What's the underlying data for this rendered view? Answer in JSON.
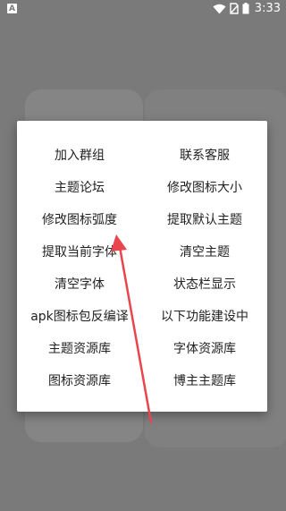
{
  "status_bar": {
    "app_badge": "A",
    "time": "3:33"
  },
  "menu": {
    "items": [
      "加入群组",
      "联系客服",
      "主题论坛",
      "修改图标大小",
      "修改图标弧度",
      "提取默认主题",
      "提取当前字体",
      "清空主题",
      "清空字体",
      "状态栏显示",
      "apk图标包反编译",
      "以下功能建设中",
      "主题资源库",
      "字体资源库",
      "图标资源库",
      "博主主题库"
    ]
  },
  "annotation": {
    "arrow_color": "#e8454d"
  }
}
